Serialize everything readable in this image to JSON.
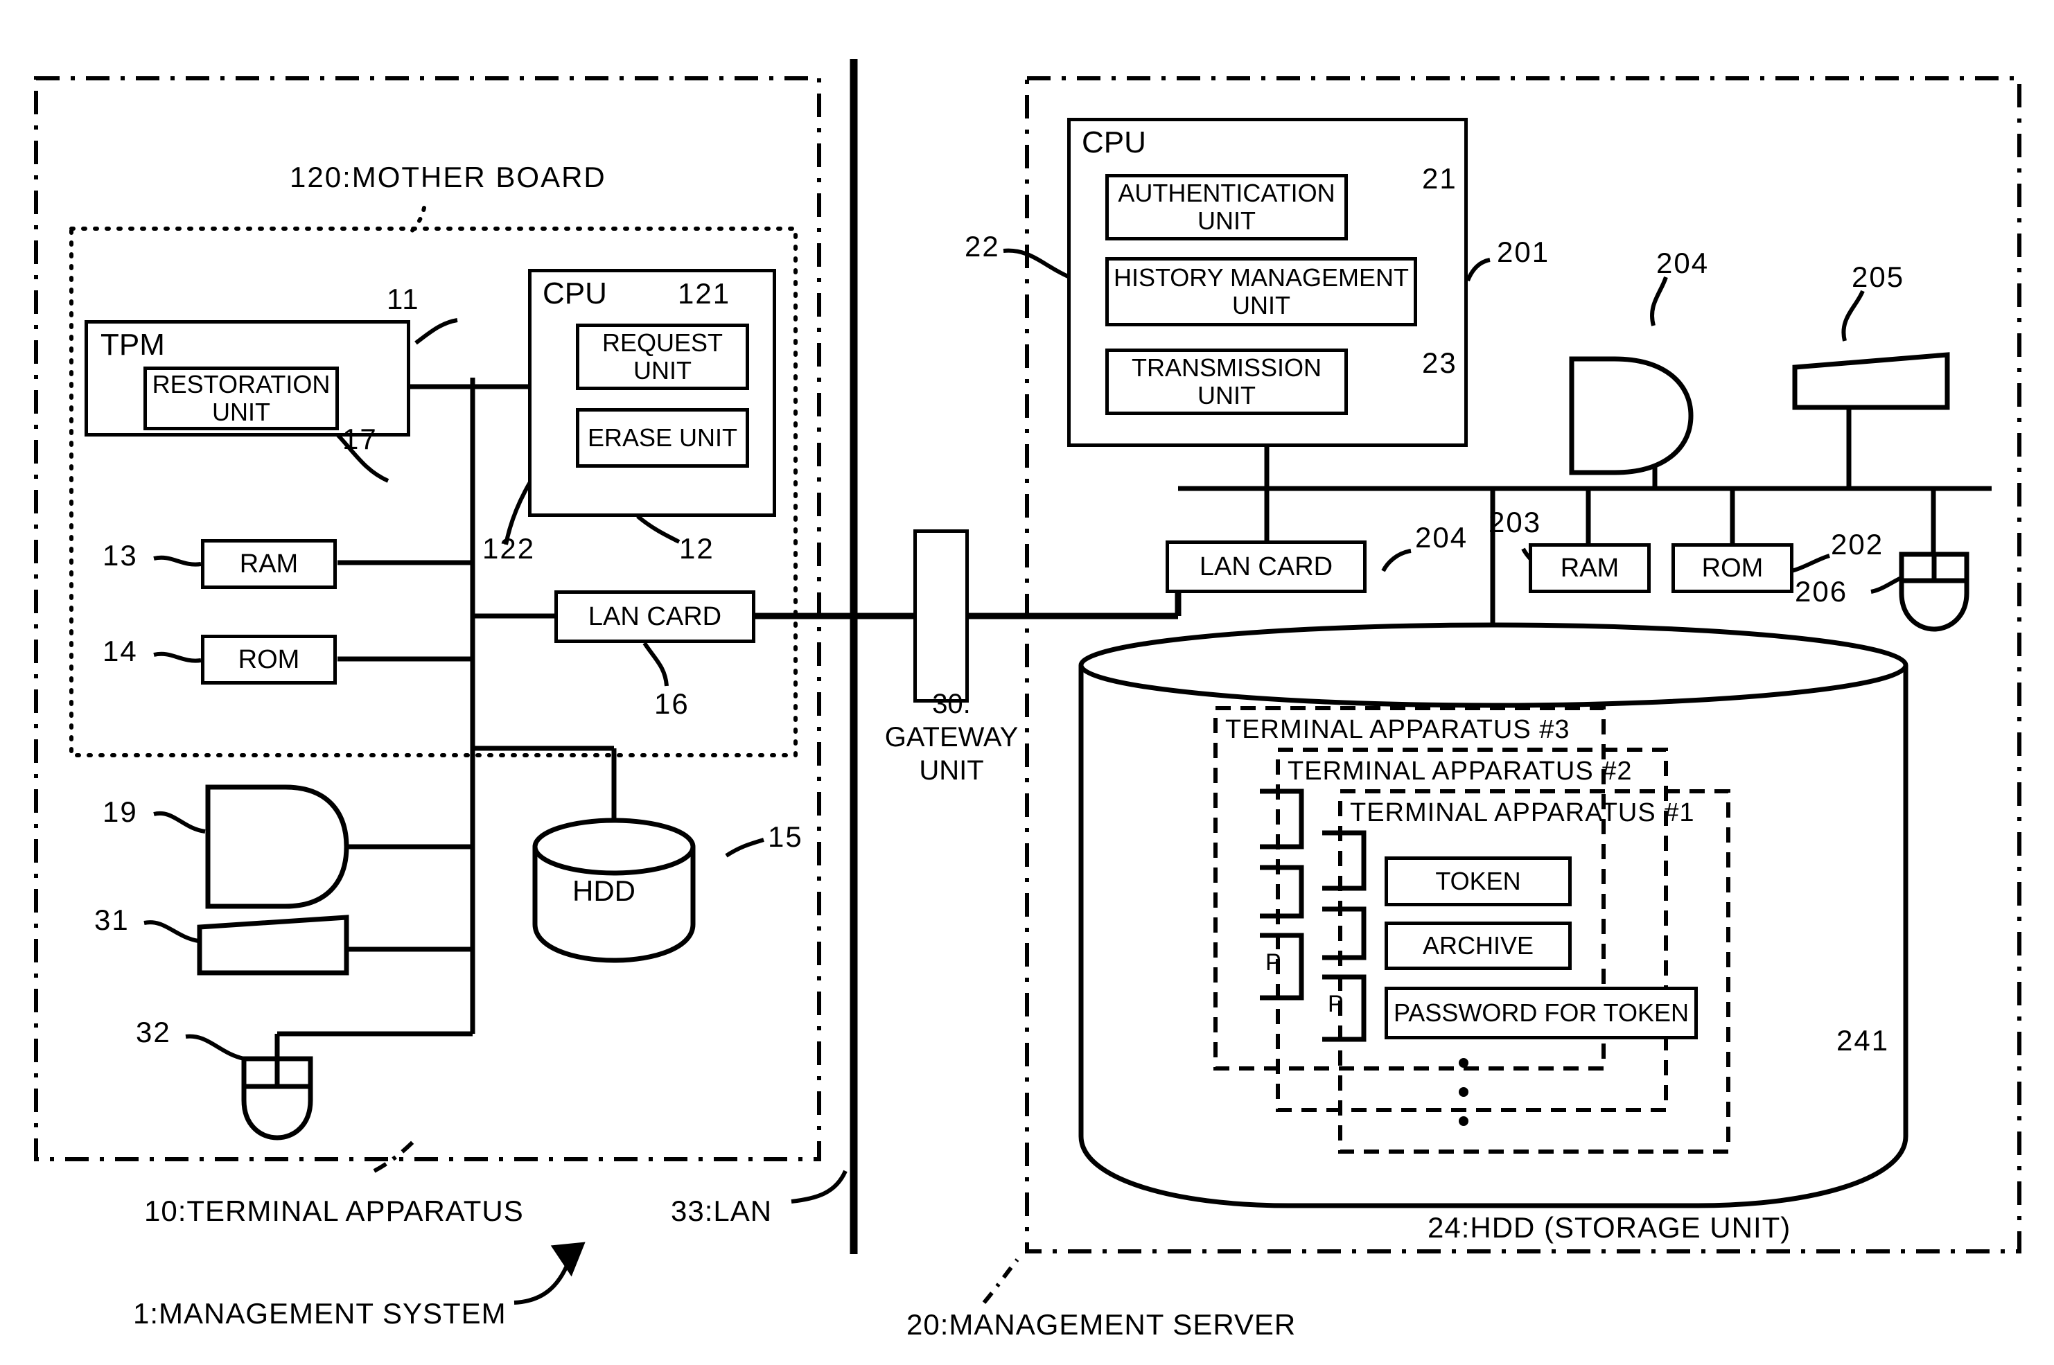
{
  "figure": {
    "system_label": "1:MANAGEMENT SYSTEM",
    "terminal_label": "10:TERMINAL APPARATUS",
    "lan_label": "33:LAN",
    "server_label": "20:MANAGEMENT SERVER",
    "hdd_storage_label": "24:HDD (STORAGE UNIT)",
    "mother_board_label": "120:MOTHER BOARD",
    "gateway_label_line1": "30:",
    "gateway_label_line2": "GATEWAY",
    "gateway_label_line3": "UNIT"
  },
  "terminal": {
    "tpm": {
      "title": "TPM",
      "inner_label": "RESTORATION UNIT",
      "ref_outer": "11",
      "ref_inner": "17"
    },
    "cpu": {
      "title": "CPU",
      "ref_cpu": "12",
      "request_unit": "REQUEST UNIT",
      "ref_request": "121",
      "erase_unit": "ERASE UNIT",
      "ref_erase": "122"
    },
    "ram": {
      "label": "RAM",
      "ref": "13"
    },
    "rom": {
      "label": "ROM",
      "ref": "14"
    },
    "lan_card": {
      "label": "LAN CARD",
      "ref": "16"
    },
    "hdd": {
      "label": "HDD",
      "ref": "15"
    },
    "display": {
      "ref": "19"
    },
    "keyboard": {
      "ref": "31"
    },
    "mouse": {
      "ref": "32"
    }
  },
  "server": {
    "cpu": {
      "title": "CPU",
      "ref_cpu": "201",
      "authentication_unit": "AUTHENTICATION UNIT",
      "ref_authentication": "21",
      "history_management_unit": "HISTORY MANAGEMENT UNIT",
      "ref_history": "22",
      "transmission_unit": "TRANSMISSION UNIT",
      "ref_transmission": "23"
    },
    "lan_card": {
      "label": "LAN CARD",
      "ref": "204"
    },
    "ram": {
      "label": "RAM",
      "ref": "203"
    },
    "rom": {
      "label": "ROM",
      "ref": "202"
    },
    "display": {
      "ref": "204"
    },
    "keyboard": {
      "ref": "205"
    },
    "mouse": {
      "ref": "206"
    },
    "hdd": {
      "record_ref": "241",
      "records": [
        {
          "title": "TERMINAL APPARATUS #3"
        },
        {
          "title": "TERMINAL APPARATUS #2"
        },
        {
          "title": "TERMINAL APPARATUS #1"
        }
      ],
      "fields": [
        "TOKEN",
        "ARCHIVE",
        "PASSWORD FOR TOKEN"
      ],
      "partial_field_2": "P",
      "partial_field_3": "P"
    }
  },
  "colors": {
    "ink": "#000000",
    "paper": "#ffffff"
  }
}
